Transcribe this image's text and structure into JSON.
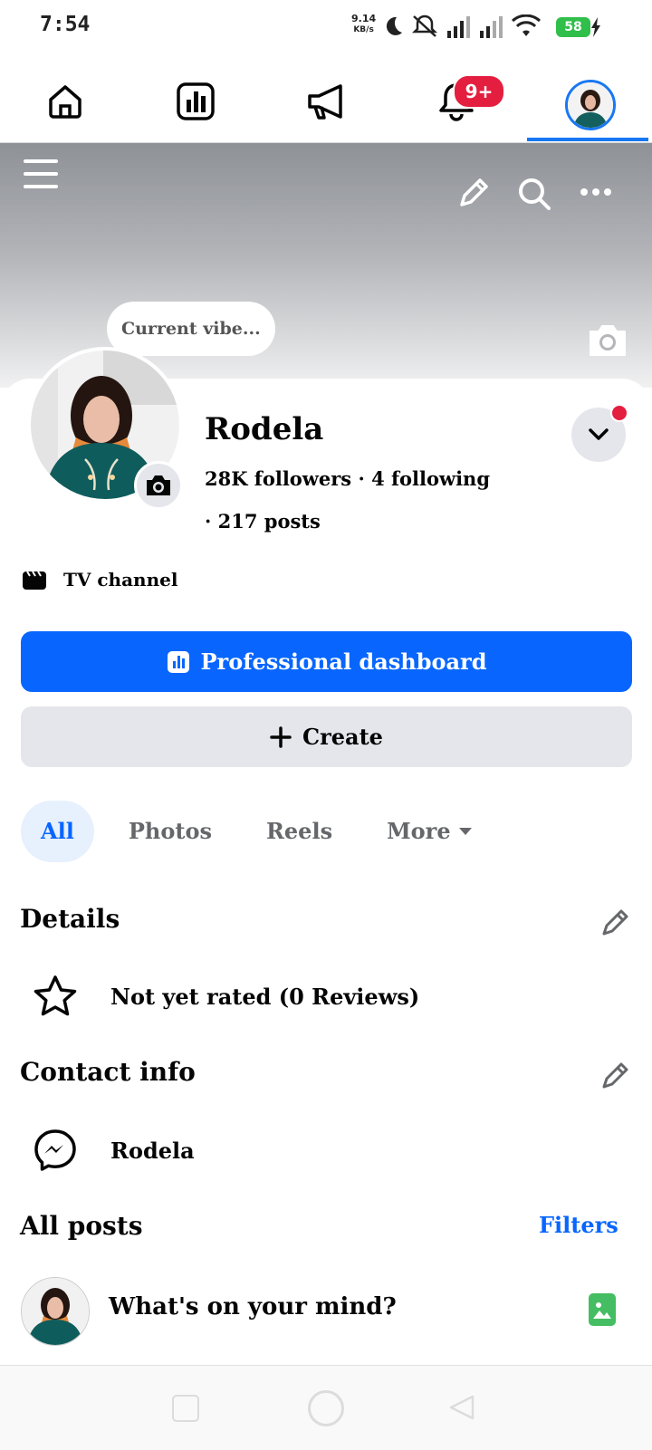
{
  "status_bar": {
    "time": "7:54",
    "net_speed_value": "9.14",
    "net_speed_unit": "KB/s",
    "battery": "58",
    "icons": [
      "moon-icon",
      "bell-off-icon",
      "signal-icon",
      "signal-icon",
      "wifi-icon",
      "battery-icon",
      "charging-icon"
    ]
  },
  "top_nav": {
    "items": [
      "home-icon",
      "dashboard-icon",
      "megaphone-icon",
      "notifications-icon",
      "profile-avatar"
    ],
    "notification_badge": "9+",
    "active_item": "profile-avatar",
    "accent_color": "#1877f2"
  },
  "cover": {
    "icons": [
      "menu-icon",
      "edit-icon",
      "search-icon",
      "more-icon",
      "camera-icon"
    ]
  },
  "profile": {
    "status_bubble": "Current vibe...",
    "name": "Rodela",
    "followers": "28K",
    "followers_label": "followers",
    "separator": "·",
    "following": "4",
    "following_label": "following",
    "posts": "217",
    "posts_label": "posts",
    "category_label": "TV channel"
  },
  "actions": {
    "primary_label": "Professional dashboard",
    "secondary_label": "Create",
    "primary_color": "#0866ff"
  },
  "tabs": {
    "items": [
      "All",
      "Photos",
      "Reels",
      "More"
    ],
    "active": "All"
  },
  "details": {
    "title": "Details",
    "rating_text": "Not yet rated (0 Reviews)"
  },
  "contact": {
    "title": "Contact info",
    "messenger_name": "Rodela"
  },
  "posts_section": {
    "title": "All posts",
    "filters_label": "Filters",
    "composer_placeholder": "What's on your mind?"
  }
}
